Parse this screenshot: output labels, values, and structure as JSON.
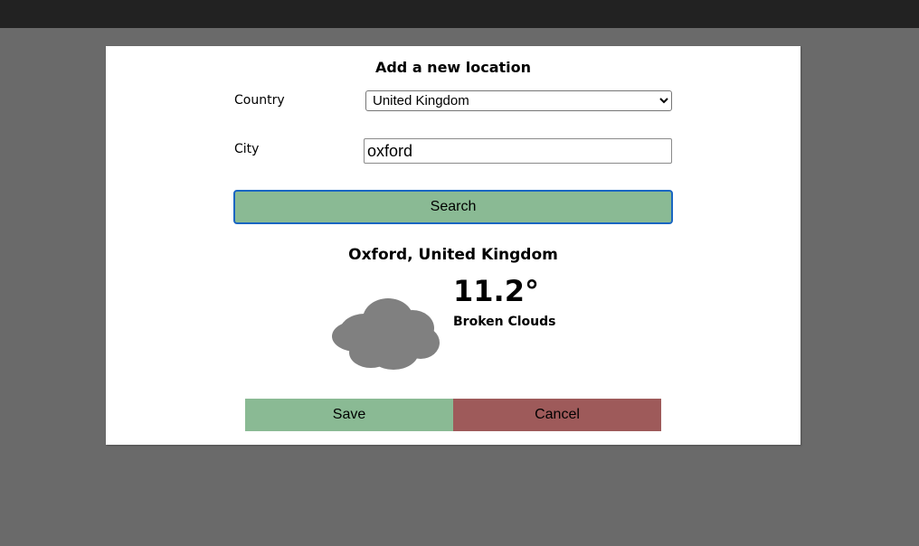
{
  "dialog": {
    "title": "Add a new location"
  },
  "form": {
    "country_label": "Country",
    "country_selected": "United Kingdom",
    "city_label": "City",
    "city_value": "oxford",
    "search_label": "Search"
  },
  "result": {
    "location": "Oxford, United Kingdom",
    "temperature": "11.2°",
    "description": "Broken Clouds",
    "icon": "cloud-icon"
  },
  "actions": {
    "save_label": "Save",
    "cancel_label": "Cancel"
  },
  "colors": {
    "overlay": "#6a6a6a",
    "topbar": "#222222",
    "save": "#8aba94",
    "cancel": "#9e5a5a",
    "search": "#8aba94",
    "focus_border": "#1a66c2",
    "cloud": "#808080"
  }
}
